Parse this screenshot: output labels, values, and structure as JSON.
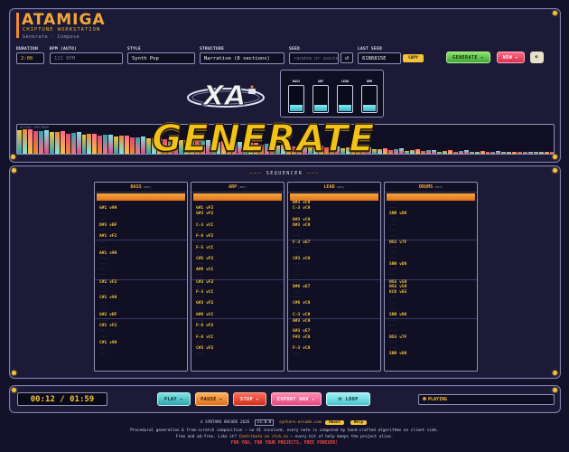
{
  "app": {
    "title": "ATAMIGA",
    "subtitle": "CHIPTUNE WORKSTATION",
    "breadcrumb": "Generate · Compose"
  },
  "fields": {
    "duration": {
      "label": "DURATION",
      "value": "2:00"
    },
    "bpm": {
      "label": "BPM (AUTO)",
      "value": "121 BPM"
    },
    "style": {
      "label": "STYLE",
      "value": "Synth Pop"
    },
    "structure": {
      "label": "STRUCTURE",
      "value": "Narrative (8 sections)"
    },
    "seed": {
      "label": "SEED",
      "placeholder": "random or paste"
    },
    "last_seed": {
      "label": "LAST SEED",
      "value": "61B6815E",
      "copy_label": "COPY"
    }
  },
  "header_buttons": {
    "generate": "GENERATE",
    "new": "NEW",
    "extra_icon": "moon-icon"
  },
  "meters": [
    {
      "label": "BASS",
      "level": 0.25
    },
    {
      "label": "ARP",
      "level": 0.25
    },
    {
      "label": "LEAD",
      "level": 0.25
    },
    {
      "label": "DRM",
      "level": 0.25
    }
  ],
  "generate_banner": "GENERATE",
  "spectrum_label": "ACTIVE SPECTRUM",
  "sequencer": {
    "title": "SEQUENCER",
    "lanes": [
      {
        "name": "BASS",
        "tag": "(PAT)",
        "rows": [
          "---",
          "G#1 v99",
          "---",
          "---",
          "D#3 vBF",
          "---",
          "A#1 vF2",
          "---",
          "---",
          "A#1 v99",
          "---",
          "---",
          "---",
          "---",
          "C#1 vF2",
          "---",
          "---",
          "C#1 v99",
          "---",
          "---",
          "G#2 vBF",
          "---",
          "C#1 vF2",
          "---",
          "---",
          "C#1 v99",
          "---",
          "---"
        ]
      },
      {
        "name": "ARP",
        "tag": "(PAT)",
        "rows": [
          "---",
          "G#1 vF2",
          "G#3 vF2",
          "---",
          "C-3 vCC",
          "---",
          "F-6 vF2",
          "---",
          "F-5 vCC",
          "---",
          "C#5 vF2",
          "---",
          "A#6 vCC",
          "---",
          "C#3 vF2",
          "---",
          "F-3 vCC",
          "---",
          "G#3 vF2",
          "---",
          "G#6 vCC",
          "---",
          "F-6 vF2",
          "---",
          "F-6 vCC",
          "---",
          "C#3 vF2",
          "---"
        ]
      },
      {
        "name": "LEAD",
        "tag": "(PAT)",
        "rows": [
          "D#3 vC9",
          "C-3 vC9",
          "---",
          "D#3 vC9",
          "D#3 vC9",
          "---",
          "---",
          "F-3 vE7",
          "---",
          "---",
          "C#3 vC9",
          "---",
          "---",
          "---",
          "---",
          "D#6 vE7",
          "---",
          "---",
          "C#6 vC9",
          "---",
          "C-3 vC9",
          "A#3 vC9",
          "---",
          "G#3 vE7",
          "F#3 vC9",
          "---",
          "F-3 vC9",
          "---"
        ]
      },
      {
        "name": "DRUMS",
        "tag": "(PAT)",
        "rows": [
          "---",
          "---",
          "SNR vD8",
          "---",
          "---",
          "---",
          "---",
          "NSS v7F",
          "---",
          "---",
          "---",
          "SNR vD8",
          "---",
          "---",
          "NSS v59",
          "NSS v59",
          "KCK vE5",
          "---",
          "---",
          "---",
          "SNR vD8",
          "---",
          "---",
          "---",
          "NSS v7F",
          "---",
          "---",
          "SNR vD8"
        ]
      }
    ]
  },
  "transport": {
    "time": "00:12 / 01:59",
    "play": "PLAY",
    "pause": "PAUSE",
    "stop": "STOP",
    "export": "EXPORT WAV",
    "loop": "LOOP",
    "status": "PLAYING"
  },
  "footer": {
    "copyright": "© SYNTARO ARCADE 2026",
    "version": "v1.0.0",
    "site": "syntaro-arcade.com",
    "about": "About",
    "help": "Help",
    "line2": "Procedural generation & from-scratch composition — no AI involved, every note is computed by hand-crafted algorithms on client side.",
    "line3a": "Free and ad-free. Like it?",
    "line3_link": "Contribute on itch.io",
    "line3b": "— every bit of help keeps the project alive.",
    "tagline": "FOR YOU, FOR YOUR PROJECTS, FREE FOREVER!"
  },
  "colors": {
    "accent": "#f2c23a",
    "orange": "#f08a2a",
    "teal": "#35b6c8",
    "panel": "#1c1a36"
  }
}
